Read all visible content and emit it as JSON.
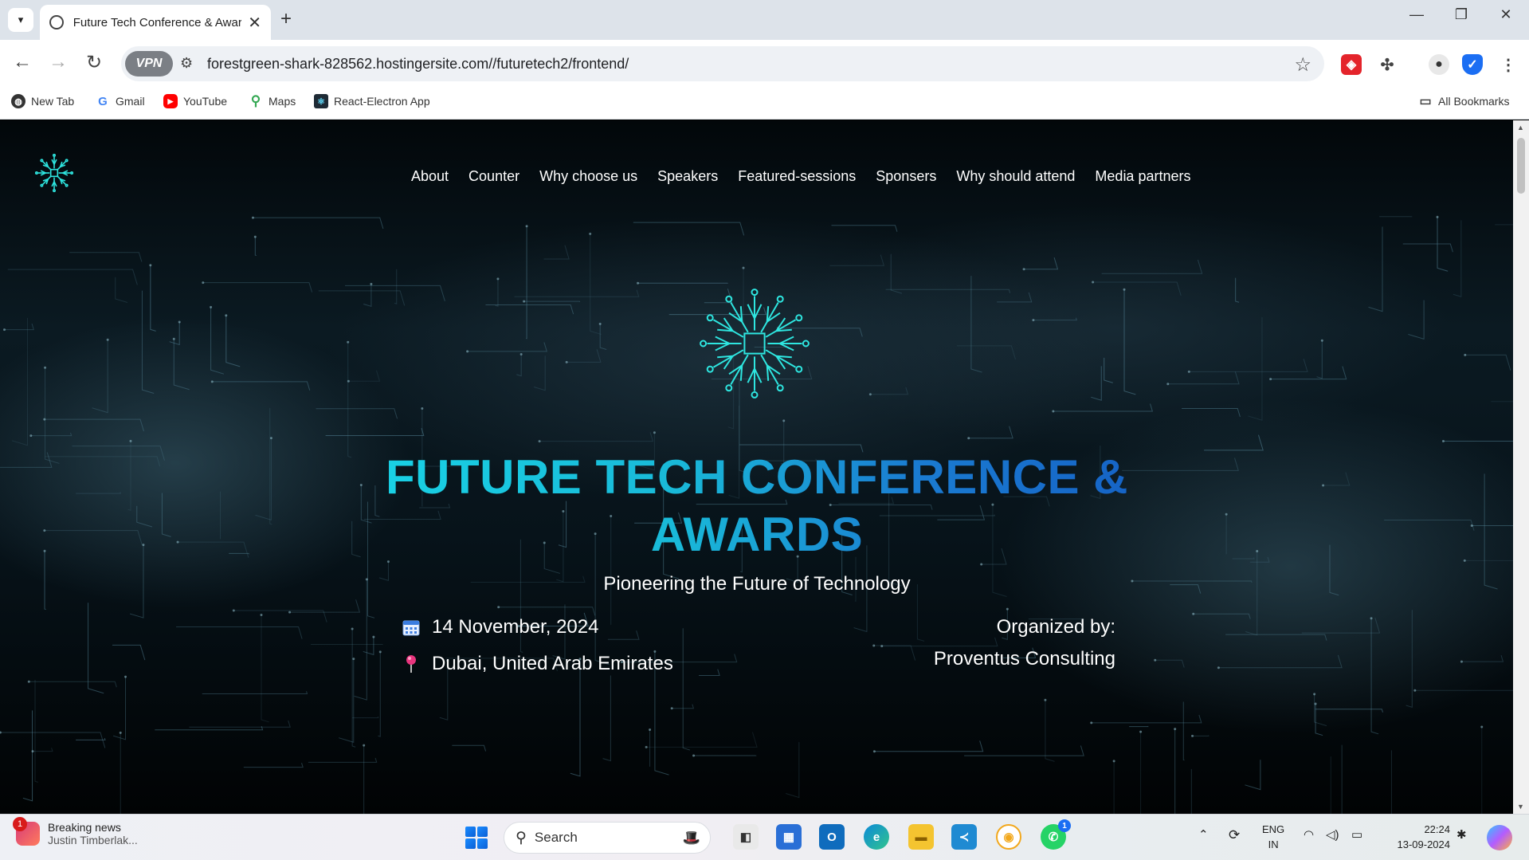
{
  "browser": {
    "tab_title": "Future Tech Conference & Awards",
    "url": "forestgreen-shark-828562.hostingersite.com//futuretech2/frontend/",
    "vpn_label": "VPN",
    "bookmarks": [
      "New Tab",
      "Gmail",
      "YouTube",
      "Maps",
      "React-Electron App"
    ],
    "all_bookmarks": "All Bookmarks"
  },
  "site": {
    "nav": [
      "About",
      "Counter",
      "Why choose us",
      "Speakers",
      "Featured-sessions",
      "Sponsers",
      "Why should attend",
      "Media partners"
    ],
    "hero": {
      "title_line1": "FUTURE TECH CONFERENCE &",
      "title_line2": "AWARDS",
      "subtitle": "Pioneering the Future of Technology",
      "date": "14 November, 2024",
      "location": "Dubai, United Arab Emirates",
      "organized_label": "Organized by:",
      "organizer": "Proventus Consulting"
    },
    "colors": {
      "title_cyan": "#19d3e6",
      "title_blue": "#1560c4",
      "logo": "#2ee6e0"
    }
  },
  "taskbar": {
    "news_title": "Breaking news",
    "news_sub": "Justin Timberlak...",
    "news_badge": "1",
    "search_placeholder": "Search",
    "whatsapp_badge": "1",
    "lang_1": "ENG",
    "lang_2": "IN",
    "time": "22:24",
    "date": "13-09-2024"
  }
}
